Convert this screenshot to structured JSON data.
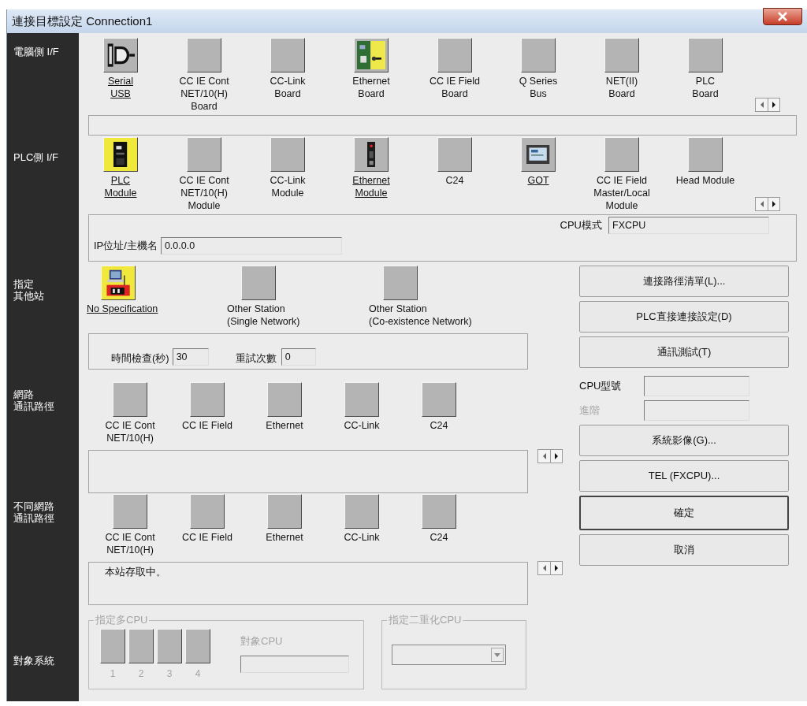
{
  "window": {
    "title": "連接目標設定 Connection1"
  },
  "pc_interface": {
    "label": "電腦側 I/F",
    "items": [
      {
        "label": "Serial\nUSB",
        "kind": "serial",
        "available": true,
        "selected": false
      },
      {
        "label": "CC IE Cont\nNET/10(H)\nBoard",
        "kind": "blank",
        "available": false,
        "selected": false
      },
      {
        "label": "CC-Link\nBoard",
        "kind": "blank",
        "available": false,
        "selected": false
      },
      {
        "label": "Ethernet\nBoard",
        "kind": "ethernet-board",
        "available": false,
        "selected": false
      },
      {
        "label": "CC IE Field\nBoard",
        "kind": "blank",
        "available": false,
        "selected": false
      },
      {
        "label": "Q Series\nBus",
        "kind": "blank",
        "available": false,
        "selected": false
      },
      {
        "label": "NET(II)\nBoard",
        "kind": "blank",
        "available": false,
        "selected": false
      },
      {
        "label": "PLC\nBoard",
        "kind": "blank",
        "available": false,
        "selected": false
      }
    ]
  },
  "plc_interface": {
    "label": "PLC側 I/F",
    "items": [
      {
        "label": "PLC\nModule",
        "kind": "plc",
        "available": true,
        "selected": true
      },
      {
        "label": "CC IE Cont\nNET/10(H)\nModule",
        "kind": "blank",
        "available": false,
        "selected": false
      },
      {
        "label": "CC-Link\nModule",
        "kind": "blank",
        "available": false,
        "selected": false
      },
      {
        "label": "Ethernet\nModule",
        "kind": "ethernet-module",
        "available": true,
        "selected": false
      },
      {
        "label": "C24",
        "kind": "blank",
        "available": false,
        "selected": false
      },
      {
        "label": "GOT",
        "kind": "got",
        "available": true,
        "selected": false
      },
      {
        "label": "CC IE Field\nMaster/Local\nModule",
        "kind": "blank",
        "available": false,
        "selected": false
      },
      {
        "label": "Head Module",
        "kind": "blank",
        "available": false,
        "selected": false
      }
    ],
    "cpu_mode": {
      "label": "CPU模式",
      "value": "FXCPU"
    },
    "ip_host": {
      "label": "IP位址/主機名",
      "value": "0.0.0.0"
    }
  },
  "other_station": {
    "label": [
      "指定",
      "其他站"
    ],
    "items": [
      {
        "label": "No Specification",
        "kind": "computer",
        "available": true,
        "selected": true
      },
      {
        "label": "Other Station\n(Single Network)",
        "kind": "blank",
        "available": false,
        "selected": false
      },
      {
        "label": "Other Station\n(Co-existence Network)",
        "kind": "blank",
        "available": false,
        "selected": false
      }
    ],
    "time_check": {
      "label": "時間檢查(秒)",
      "value": "30"
    },
    "retry": {
      "label": "重試次數",
      "value": "0"
    }
  },
  "network_route": {
    "label": [
      "網路",
      "通訊路徑"
    ],
    "items": [
      {
        "label": "CC IE Cont\nNET/10(H)",
        "available": false,
        "selected": false
      },
      {
        "label": "CC IE Field",
        "available": false,
        "selected": false
      },
      {
        "label": "Ethernet",
        "available": false,
        "selected": false
      },
      {
        "label": "CC-Link",
        "available": false,
        "selected": false
      },
      {
        "label": "C24",
        "available": false,
        "selected": false
      }
    ]
  },
  "co_existence_route": {
    "label": [
      "不同網路",
      "通訊路徑"
    ],
    "items": [
      {
        "label": "CC IE Cont\nNET/10(H)",
        "available": false,
        "selected": false
      },
      {
        "label": "CC IE Field",
        "available": false,
        "selected": false
      },
      {
        "label": "Ethernet",
        "available": false,
        "selected": false
      },
      {
        "label": "CC-Link",
        "available": false,
        "selected": false
      },
      {
        "label": "C24",
        "available": false,
        "selected": false
      }
    ],
    "status": "本站存取中。"
  },
  "target_system": {
    "label": "對象系統",
    "multi_cpu": {
      "title": "指定多CPU",
      "disabled": true,
      "cpus": [
        "1",
        "2",
        "3",
        "4"
      ],
      "target_label": "對象CPU"
    },
    "redundant_cpu": {
      "title": "指定二重化CPU",
      "disabled": true
    }
  },
  "buttons_top": [
    {
      "label": "連接路徑清單(L)...",
      "default": false
    },
    {
      "label": "PLC直接連接設定(D)",
      "default": false
    },
    {
      "label": "通訊測試(T)",
      "default": false
    }
  ],
  "cpu_fields": [
    {
      "label": "CPU型號",
      "disabled": false
    },
    {
      "label": "進階",
      "disabled": true
    }
  ],
  "buttons_bottom": [
    {
      "label": "系統影像(G)...",
      "default": false
    },
    {
      "label": "TEL (FXCPU)...",
      "default": false
    },
    {
      "label": "確定",
      "default": true
    },
    {
      "label": "取消",
      "default": false
    }
  ]
}
